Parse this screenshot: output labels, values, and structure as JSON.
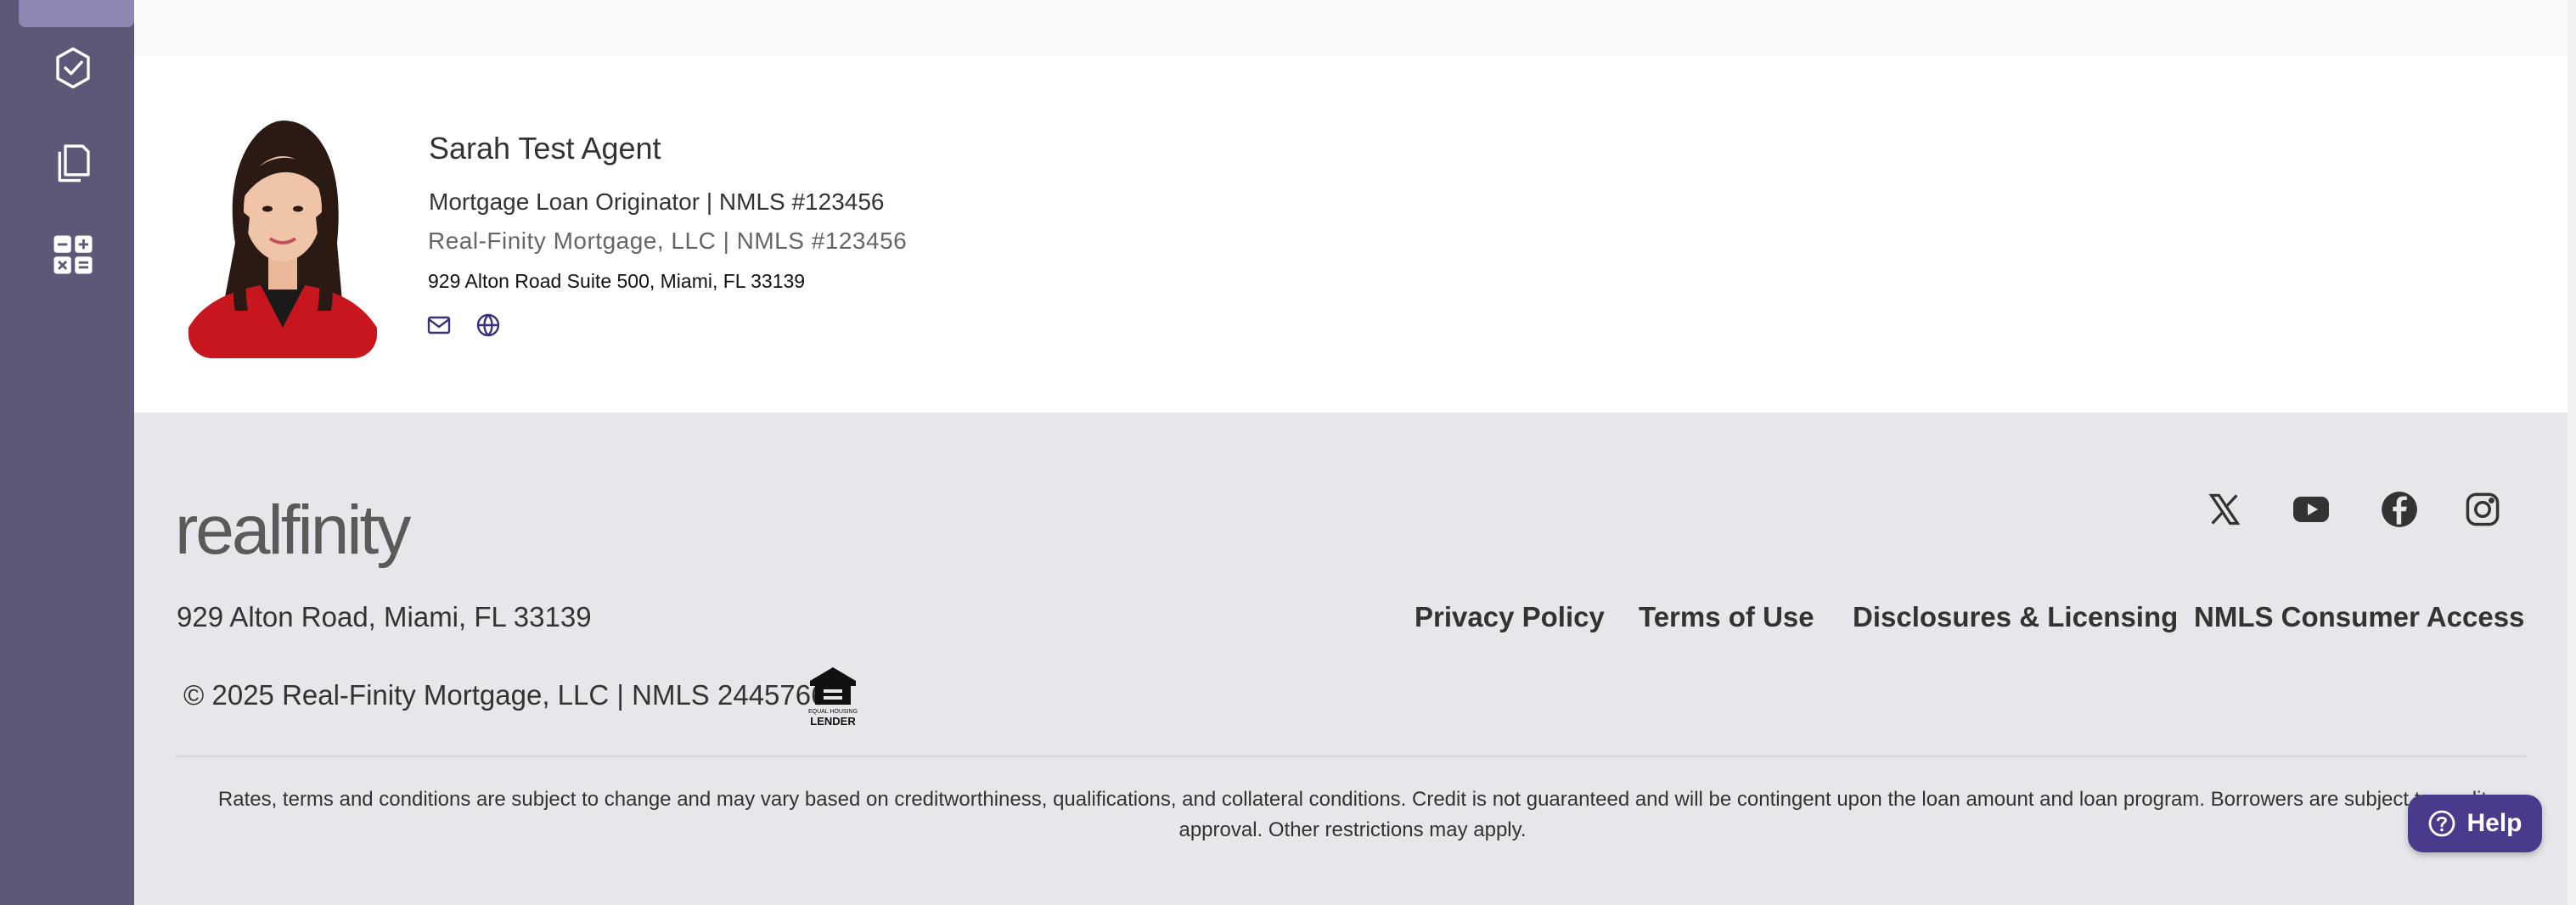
{
  "sidebar": {
    "icons": [
      "check-badge-icon",
      "documents-icon",
      "calculator-icon"
    ]
  },
  "agent": {
    "name": "Sarah Test Agent",
    "title": "Mortgage Loan Originator | NMLS #123456",
    "company": "Real-Finity Mortgage, LLC  |  NMLS #123456",
    "address": "929 Alton Road Suite 500, Miami, FL 33139"
  },
  "footer": {
    "logo_text": "realfinity",
    "address": "929 Alton Road, Miami, FL 33139",
    "links": {
      "privacy": "Privacy Policy",
      "terms": "Terms of Use",
      "disclosures": "Disclosures & Licensing",
      "nmls": "NMLS Consumer Access"
    },
    "copyright": "© 2025 Real-Finity Mortgage, LLC | NMLS 2445766",
    "ehl_text_top": "EQUAL HOUSING",
    "ehl_text_bottom": "LENDER",
    "disclaimer": "Rates, terms and conditions are subject to change and may vary based on creditworthiness, qualifications, and collateral conditions. Credit is not guaranteed and will be contingent upon the loan amount and loan program. Borrowers are subject to credit approval. Other restrictions may apply.",
    "social": [
      "x-icon",
      "youtube-icon",
      "facebook-icon",
      "instagram-icon"
    ]
  },
  "help": {
    "label": "Help"
  },
  "colors": {
    "sidebar": "#5d5878",
    "accent": "#4a3a8c",
    "footer_bg": "#e6e7ea"
  }
}
